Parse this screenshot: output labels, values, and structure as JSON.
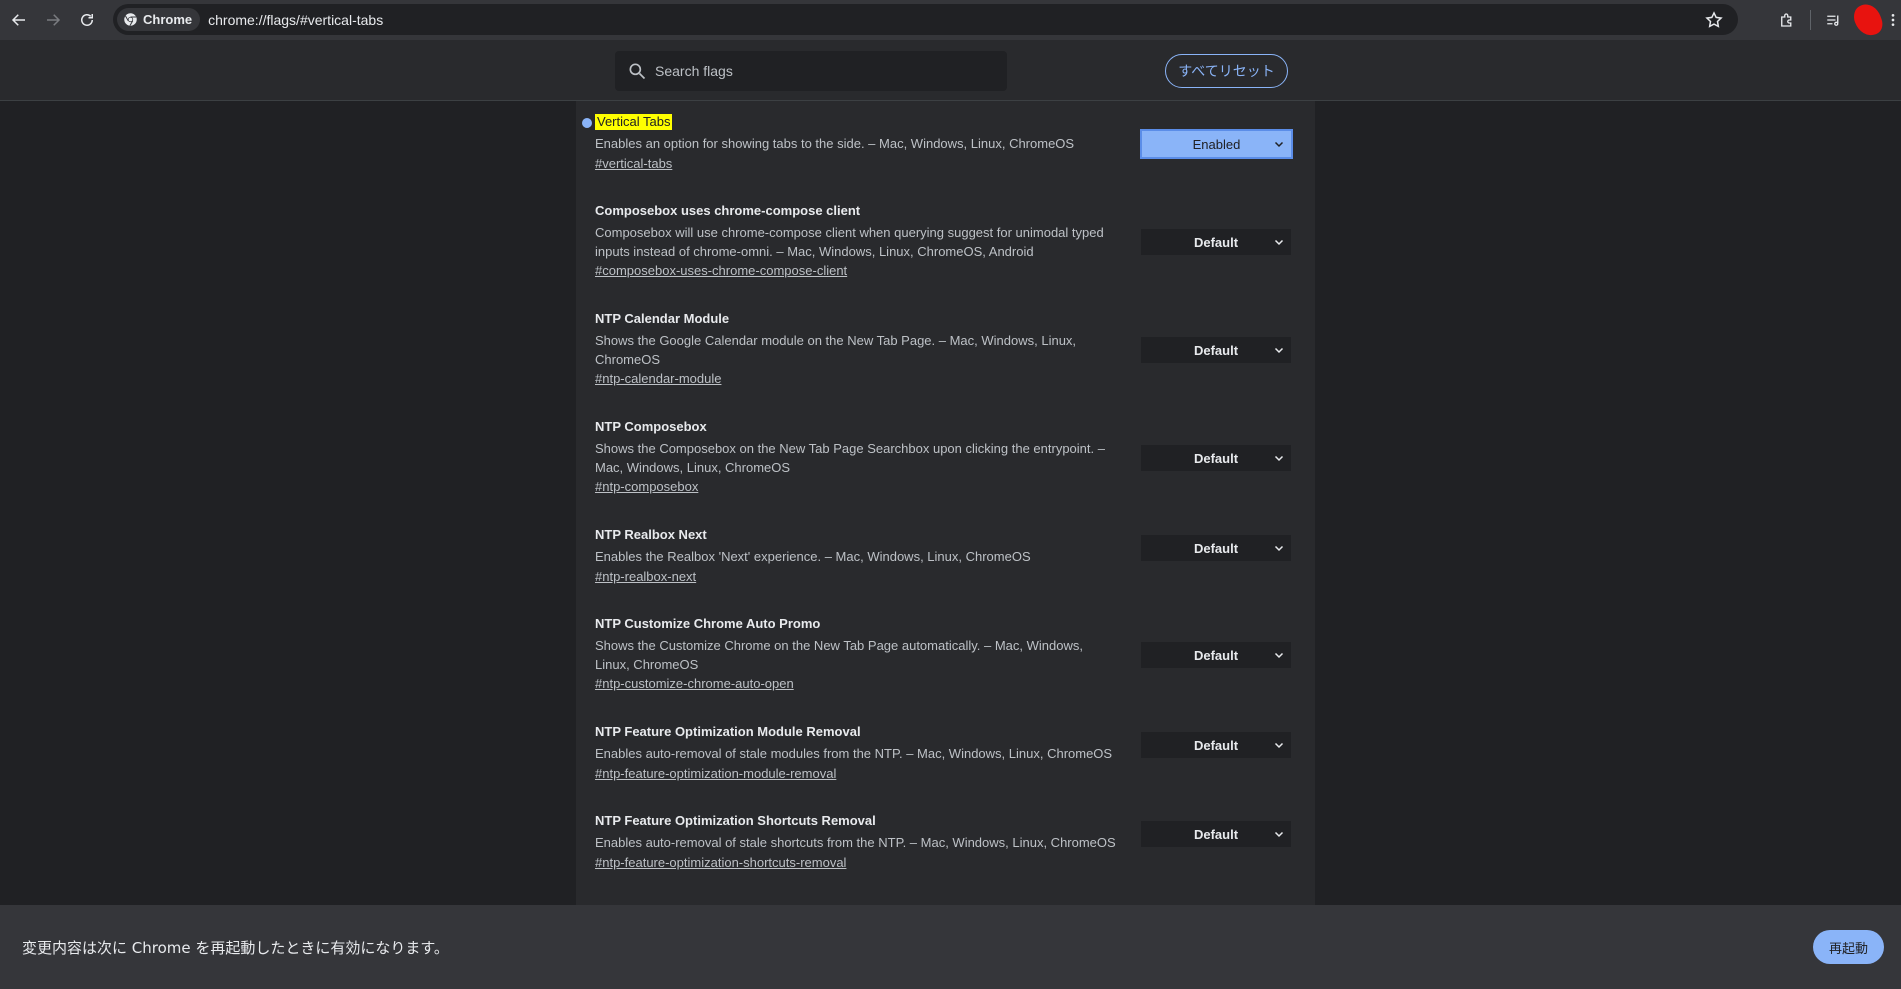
{
  "browser": {
    "chip_label": "Chrome",
    "url": "chrome://flags/#vertical-tabs"
  },
  "header": {
    "search_placeholder": "Search flags",
    "reset_all_label": "すべてリセット"
  },
  "flags": [
    {
      "title": "Vertical Tabs",
      "description": "Enables an option for showing tabs to the side. – Mac, Windows, Linux, ChromeOS",
      "link": "#vertical-tabs",
      "value": "Enabled"
    },
    {
      "title": "Composebox uses chrome-compose client",
      "description": "Composebox will use chrome-compose client when querying suggest for unimodal typed inputs instead of chrome-omni. – Mac, Windows, Linux, ChromeOS, Android",
      "link": "#composebox-uses-chrome-compose-client",
      "value": "Default"
    },
    {
      "title": "NTP Calendar Module",
      "description": "Shows the Google Calendar module on the New Tab Page. – Mac, Windows, Linux, ChromeOS",
      "link": "#ntp-calendar-module",
      "value": "Default"
    },
    {
      "title": "NTP Composebox",
      "description": "Shows the Composebox on the New Tab Page Searchbox upon clicking the entrypoint. – Mac, Windows, Linux, ChromeOS",
      "link": "#ntp-composebox",
      "value": "Default"
    },
    {
      "title": "NTP Realbox Next",
      "description": "Enables the Realbox 'Next' experience. – Mac, Windows, Linux, ChromeOS",
      "link": "#ntp-realbox-next",
      "value": "Default"
    },
    {
      "title": "NTP Customize Chrome Auto Promo",
      "description": "Shows the Customize Chrome on the New Tab Page automatically. – Mac, Windows, Linux, ChromeOS",
      "link": "#ntp-customize-chrome-auto-open",
      "value": "Default"
    },
    {
      "title": "NTP Feature Optimization Module Removal",
      "description": "Enables auto-removal of stale modules from the NTP. – Mac, Windows, Linux, ChromeOS",
      "link": "#ntp-feature-optimization-module-removal",
      "value": "Default"
    },
    {
      "title": "NTP Feature Optimization Shortcuts Removal",
      "description": "Enables auto-removal of stale shortcuts from the NTP. – Mac, Windows, Linux, ChromeOS",
      "link": "#ntp-feature-optimization-shortcuts-removal",
      "value": "Default"
    }
  ],
  "footer": {
    "message": "変更内容は次に Chrome を再起動したときに有効になります。",
    "relaunch_label": "再起動"
  },
  "colors": {
    "accent": "#8ab4f8",
    "highlight": "#ffff00"
  }
}
